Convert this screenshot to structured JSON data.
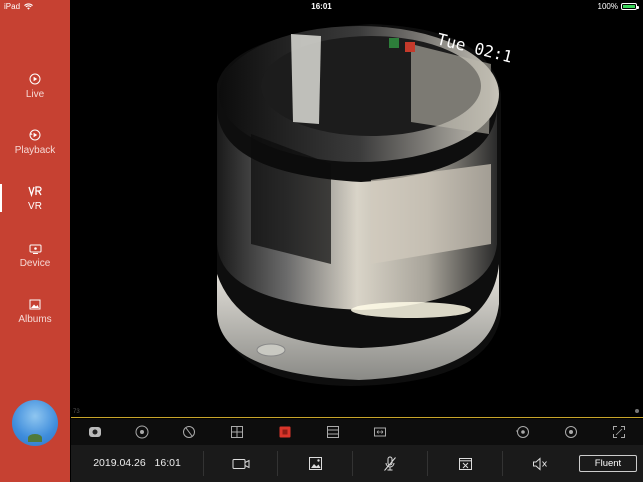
{
  "status_bar": {
    "device": "iPad",
    "time": "16:01",
    "battery_percent": "100%"
  },
  "sidebar": {
    "items": [
      {
        "label": "Live",
        "icon": "live-icon"
      },
      {
        "label": "Playback",
        "icon": "playback-icon"
      },
      {
        "label": "VR",
        "icon": "vr-icon",
        "active": true
      },
      {
        "label": "Device",
        "icon": "device-icon"
      },
      {
        "label": "Albums",
        "icon": "albums-icon"
      }
    ],
    "avatar": "avatar-image"
  },
  "video": {
    "overlay_text": "Tue 02:1",
    "corner_number": "73"
  },
  "tools": [
    {
      "icon": "ptz-camera-icon"
    },
    {
      "icon": "fisheye-view-icon"
    },
    {
      "icon": "rotate-view-icon"
    },
    {
      "icon": "quad-view-icon"
    },
    {
      "icon": "record-icon-active"
    },
    {
      "icon": "panorama-view-icon"
    },
    {
      "icon": "expand-horizontal-icon"
    },
    {
      "icon": "cylinder-view-icon"
    },
    {
      "icon": "circle-view-icon"
    },
    {
      "icon": "fullscreen-icon"
    }
  ],
  "bottom_bar": {
    "date": "2019.04.26",
    "time": "16:01",
    "buttons": [
      "record-video-icon",
      "snapshot-icon",
      "mic-off-icon",
      "close-window-icon",
      "mute-icon"
    ],
    "quality_label": "Fluent"
  },
  "colors": {
    "sidebar": "#c64132",
    "accent": "#c8a52a",
    "record": "#d9352a"
  }
}
